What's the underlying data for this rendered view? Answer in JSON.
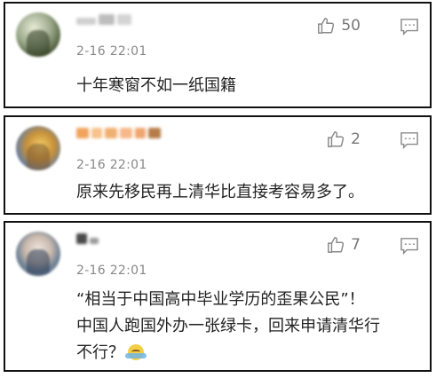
{
  "comments": [
    {
      "timestamp": "2-16 22:01",
      "likes": "50",
      "text": "十年寒窗不如一纸国籍",
      "icons": {
        "like": "thumbs-up-icon",
        "reply": "comment-icon"
      }
    },
    {
      "timestamp": "2-16 22:01",
      "likes": "2",
      "text": "原来先移民再上清华比直接考容易多了。",
      "icons": {
        "like": "thumbs-up-icon",
        "reply": "comment-icon"
      }
    },
    {
      "timestamp": "2-16 22:01",
      "likes": "7",
      "text_lines": [
        "“相当于中国高中毕业学历的歪果公民”！",
        "中国人跑国外办一张绿卡，回来申请清华行",
        "不行？"
      ],
      "emoji": "emoji-covering-face-icon",
      "icons": {
        "like": "thumbs-up-icon",
        "reply": "comment-icon"
      }
    }
  ],
  "colors": {
    "card_border": "#111111",
    "text": "#222222",
    "timestamp": "#888888",
    "icon": "#8a8a8a"
  }
}
